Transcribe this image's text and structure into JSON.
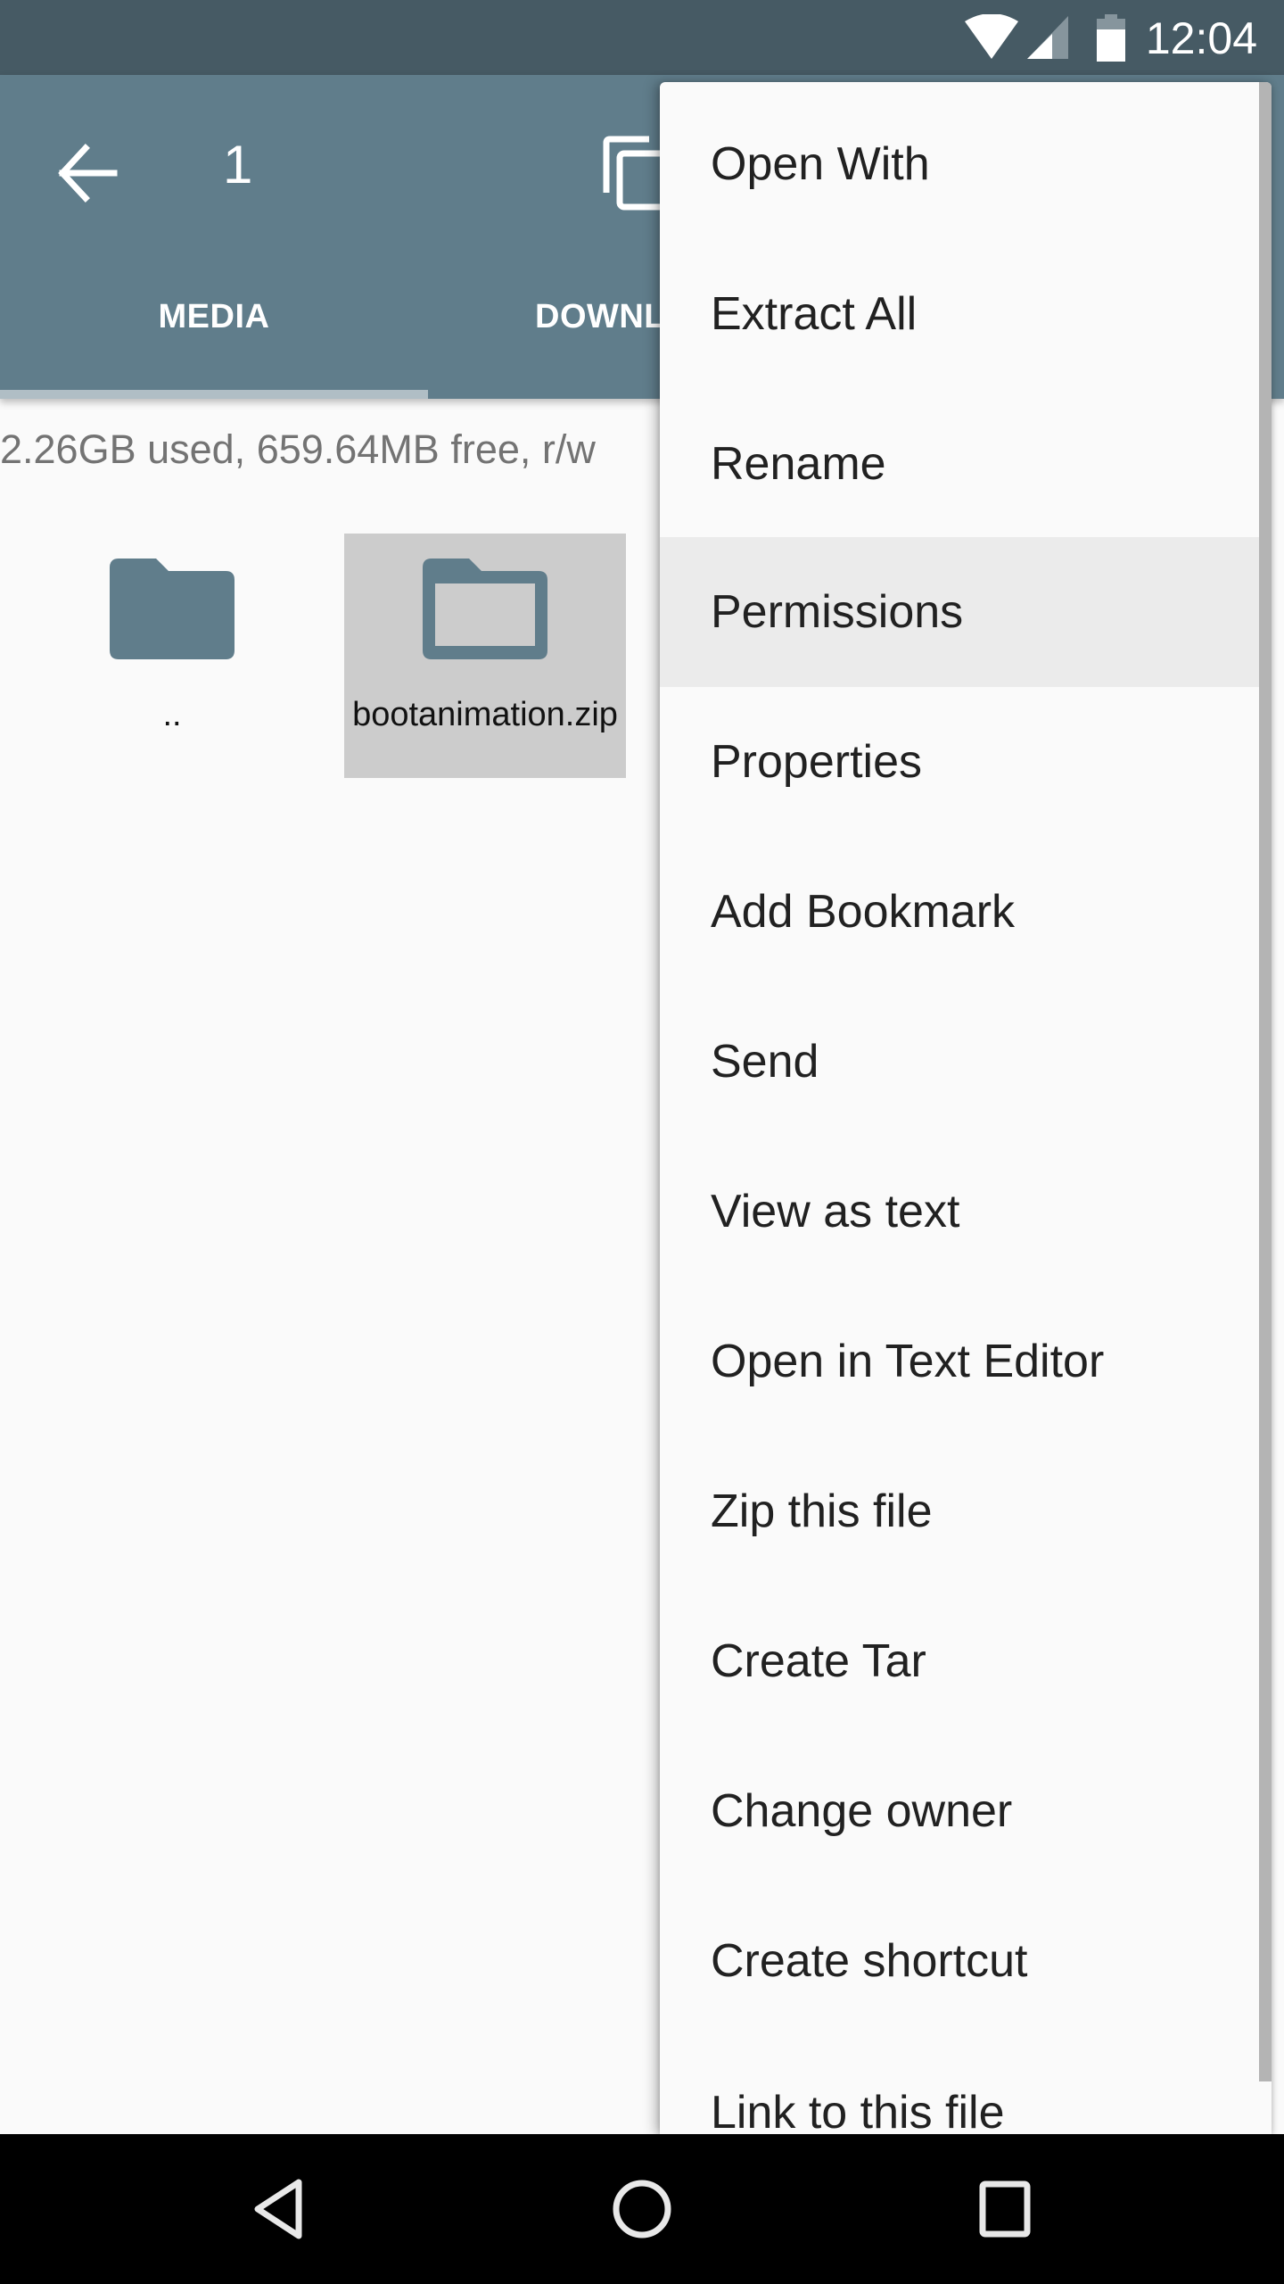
{
  "status_bar": {
    "time": "12:04",
    "icons": [
      "wifi-icon",
      "signal-icon",
      "battery-icon"
    ],
    "battery_level": 0.75,
    "signal_level": 0.5
  },
  "app_bar": {
    "back_icon": "arrow-left-icon",
    "selection_count": "1",
    "copy_icon": "copy-icon",
    "tabs": [
      {
        "label": "MEDIA",
        "active": true
      },
      {
        "label": "DOWNL"
      }
    ]
  },
  "content": {
    "storage_info": "2.26GB used, 659.64MB free, r/w",
    "files": [
      {
        "name": "..",
        "icon": "folder-icon",
        "selected": false
      },
      {
        "name": "bootanimation.zip",
        "icon": "folder-outline-icon",
        "selected": true
      }
    ]
  },
  "context_menu": {
    "items": [
      {
        "label": "Open With"
      },
      {
        "label": "Extract All"
      },
      {
        "label": "Rename"
      },
      {
        "label": "Permissions",
        "highlighted": true
      },
      {
        "label": "Properties"
      },
      {
        "label": "Add Bookmark"
      },
      {
        "label": "Send"
      },
      {
        "label": "View as text"
      },
      {
        "label": "Open in Text Editor"
      },
      {
        "label": "Zip this file"
      },
      {
        "label": "Create Tar"
      },
      {
        "label": "Change owner"
      },
      {
        "label": "Create shortcut"
      },
      {
        "label": "Link to this file"
      }
    ]
  },
  "colors": {
    "status_bar": "#465a64",
    "app_bar": "#607d8b",
    "tab_indicator": "#b0bec5",
    "folder": "#607d8b",
    "selected_tile": "#cccccc",
    "menu_highlight": "#ebebeb"
  },
  "nav_bar": {
    "buttons": [
      "back-triangle-icon",
      "home-circle-icon",
      "recents-square-icon"
    ]
  }
}
